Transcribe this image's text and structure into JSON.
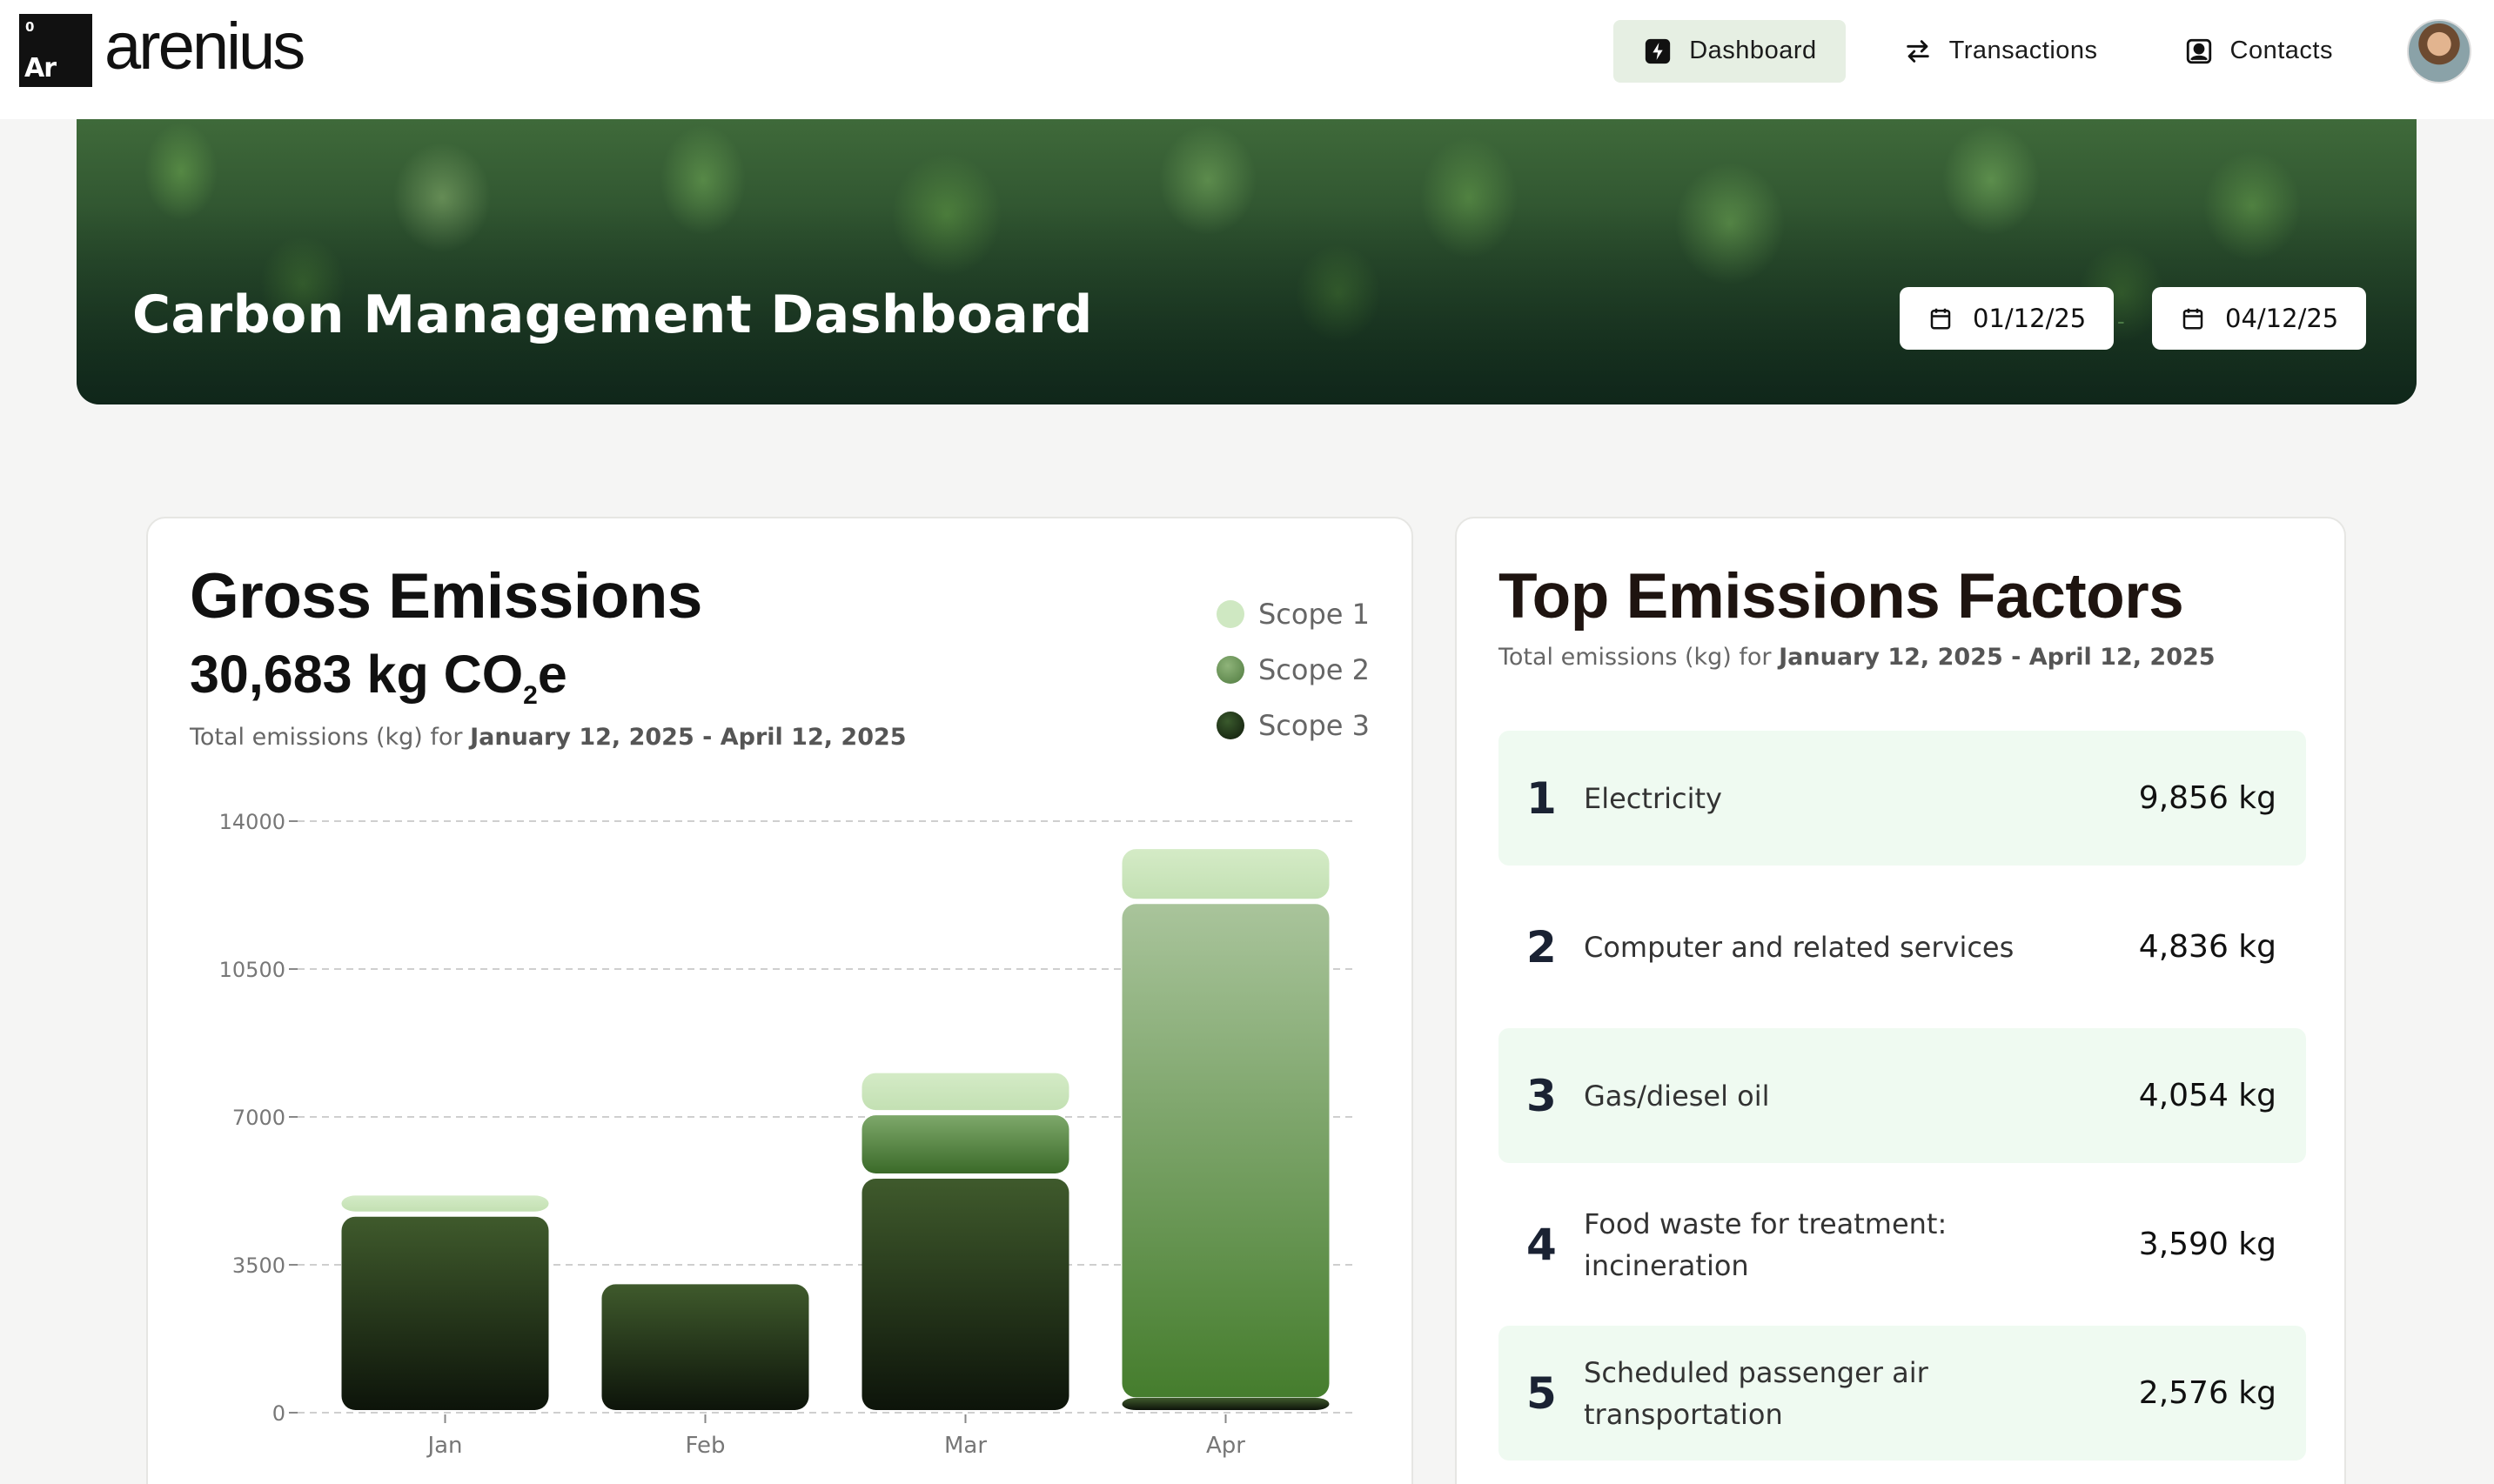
{
  "app": {
    "logo_number": "0",
    "logo_symbol": "Ar",
    "logo_word": "arenius"
  },
  "nav": {
    "items": [
      {
        "label": "Dashboard",
        "icon": "lightning-icon",
        "active": true
      },
      {
        "label": "Transactions",
        "icon": "swap-arrows-icon",
        "active": false
      },
      {
        "label": "Contacts",
        "icon": "contact-card-icon",
        "active": false
      }
    ]
  },
  "banner": {
    "title": "Carbon Management Dashboard",
    "start_date": "01/12/25",
    "end_date": "04/12/25",
    "date_separator": "-"
  },
  "gross": {
    "title": "Gross Emissions",
    "total_prefix": "30,683 kg CO",
    "total_sub": "2",
    "total_suffix": "e",
    "caption_prefix": "Total emissions (kg) for ",
    "caption_range": "January 12, 2025 - April 12, 2025",
    "legend": [
      {
        "label": "Scope 1",
        "color": "#cfe8c2"
      },
      {
        "label": "Scope 2",
        "color": "#6f9a5c"
      },
      {
        "label": "Scope 3",
        "color": "#1e3316"
      }
    ]
  },
  "chart_data": {
    "type": "bar",
    "stacked": true,
    "categories": [
      "Jan",
      "Feb",
      "Mar",
      "Apr"
    ],
    "series": [
      {
        "name": "Scope 3",
        "values": [
          4700,
          3100,
          5600,
          300
        ]
      },
      {
        "name": "Scope 2",
        "values": [
          0,
          0,
          1500,
          11800
        ]
      },
      {
        "name": "Scope 1",
        "values": [
          500,
          0,
          1000,
          1300
        ]
      }
    ],
    "yticks": [
      0,
      3500,
      7000,
      10500,
      14000
    ],
    "ylim": [
      0,
      14000
    ],
    "grid": true,
    "legend_position": "top-right"
  },
  "factors": {
    "title": "Top Emissions Factors",
    "caption_prefix": "Total emissions (kg) for ",
    "caption_range": "January 12, 2025 - April 12, 2025",
    "items": [
      {
        "rank": "1",
        "name": "Electricity",
        "value": "9,856 kg"
      },
      {
        "rank": "2",
        "name": "Computer and related services",
        "value": "4,836 kg"
      },
      {
        "rank": "3",
        "name": "Gas/diesel oil",
        "value": "4,054 kg"
      },
      {
        "rank": "4",
        "name": "Food waste for treatment: incineration",
        "value": "3,590 kg"
      },
      {
        "rank": "5",
        "name": "Scheduled passenger air transportation",
        "value": "2,576 kg"
      }
    ]
  }
}
